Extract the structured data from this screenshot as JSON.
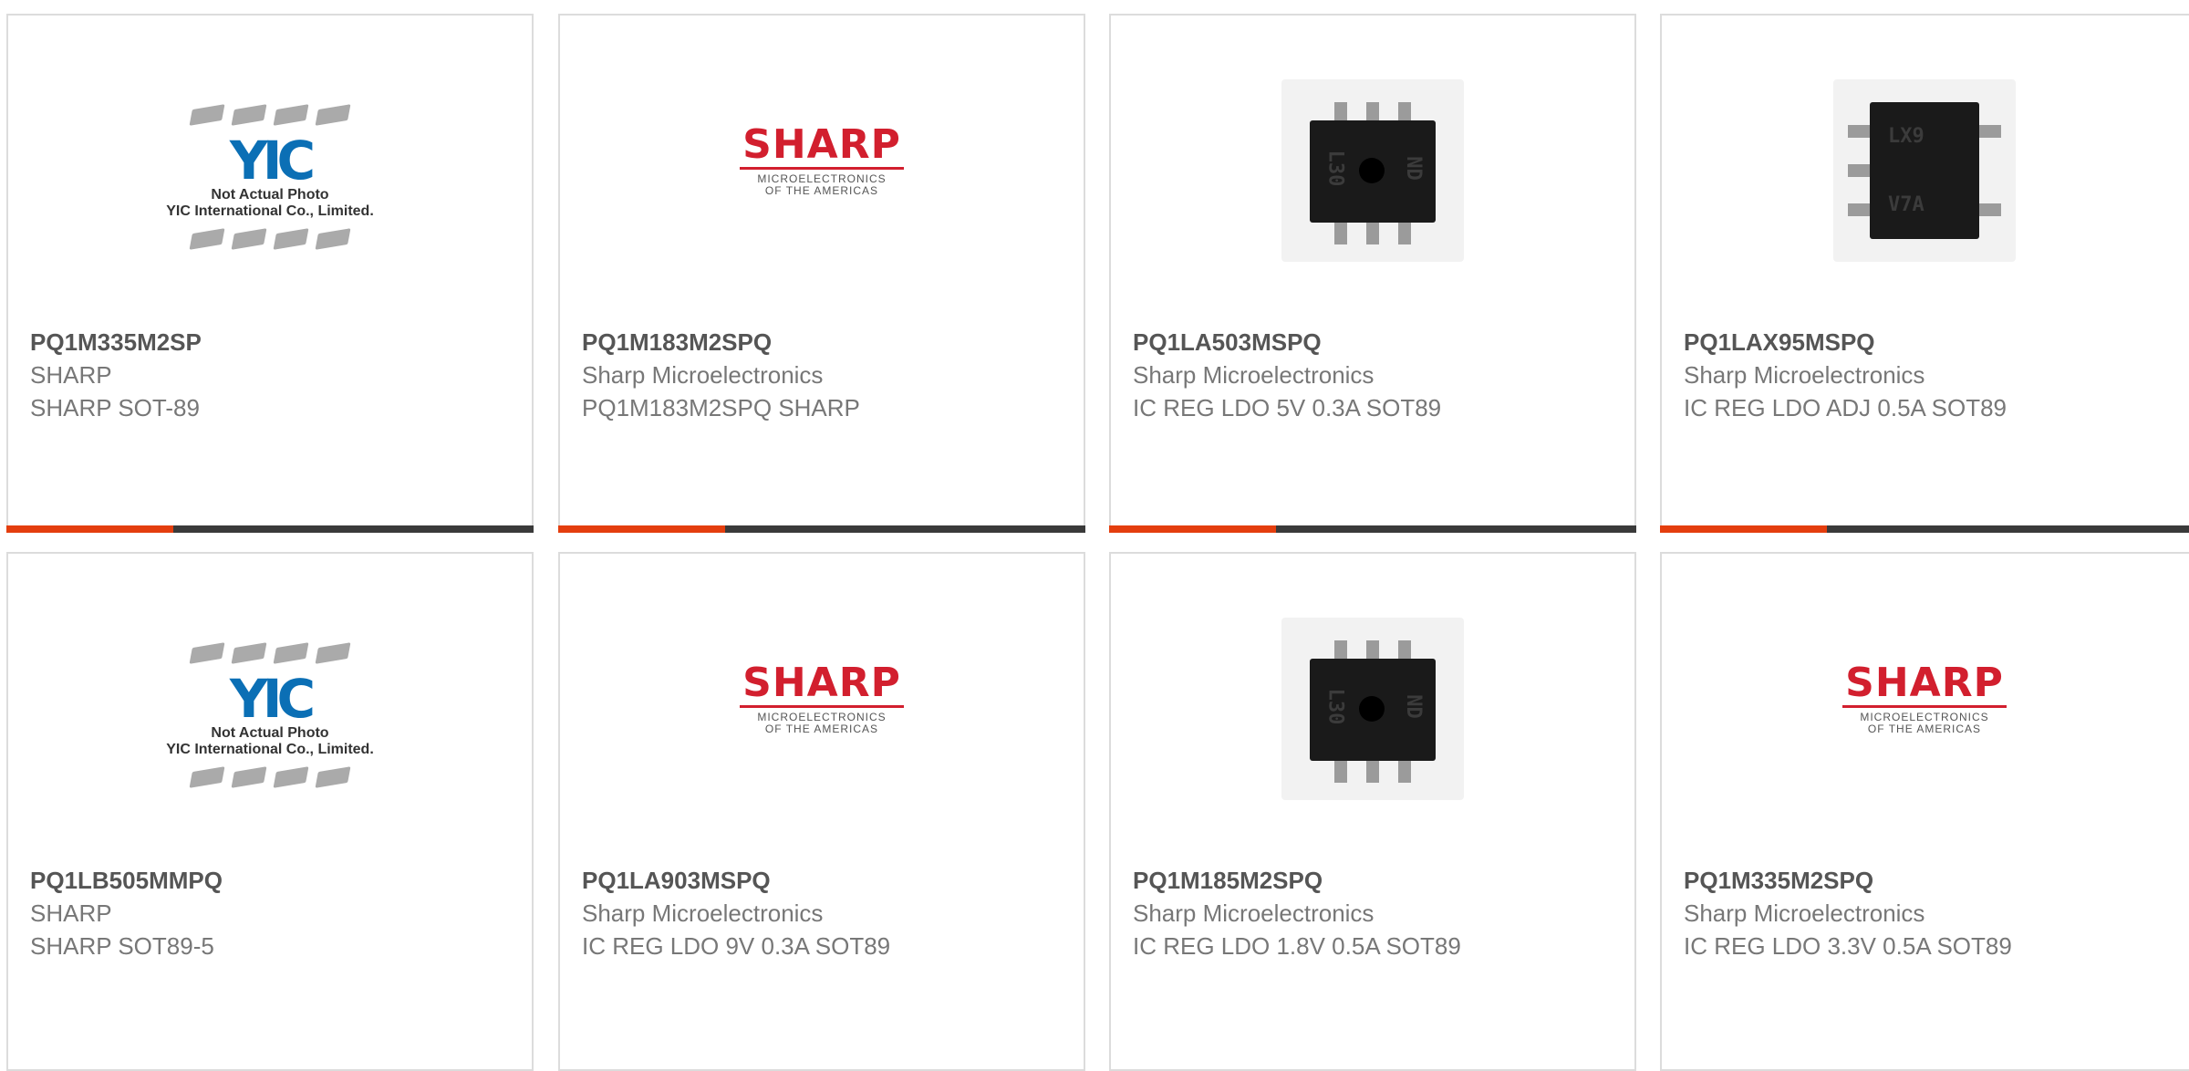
{
  "colors": {
    "accent": "#e43e0e",
    "bar": "#3a3a3a",
    "sharp_red": "#d21f2e",
    "yic_blue": "#0b6fb5"
  },
  "placeholders": {
    "yic_note_line1": "Not Actual Photo",
    "yic_note_line2": "YIC International Co., Limited.",
    "yic_mark": "YIC",
    "sharp_brand": "SHARP",
    "sharp_sub1": "MICROELECTRONICS",
    "sharp_sub2": "OF THE AMERICAS"
  },
  "products": [
    {
      "part_number": "PQ1M335M2SP",
      "manufacturer": "SHARP",
      "description": "SHARP SOT-89",
      "image": "yic-placeholder"
    },
    {
      "part_number": "PQ1M183M2SPQ",
      "manufacturer": "Sharp Microelectronics",
      "description": "PQ1M183M2SPQ SHARP",
      "image": "sharp-logo"
    },
    {
      "part_number": "PQ1LA503MSPQ",
      "manufacturer": "Sharp Microelectronics",
      "description": "IC REG LDO 5V 0.3A SOT89",
      "image": "chip-photo",
      "marking": "L30 ND"
    },
    {
      "part_number": "PQ1LAX95MSPQ",
      "manufacturer": "Sharp Microelectronics",
      "description": "IC REG LDO ADJ 0.5A SOT89",
      "image": "chip-photo",
      "marking": "LX9 V7A"
    },
    {
      "part_number": "PQ1LB505MMPQ",
      "manufacturer": "SHARP",
      "description": "SHARP SOT89-5",
      "image": "yic-placeholder"
    },
    {
      "part_number": "PQ1LA903MSPQ",
      "manufacturer": "Sharp Microelectronics",
      "description": "IC REG LDO 9V 0.3A SOT89",
      "image": "sharp-logo"
    },
    {
      "part_number": "PQ1M185M2SPQ",
      "manufacturer": "Sharp Microelectronics",
      "description": "IC REG LDO 1.8V 0.5A SOT89",
      "image": "chip-photo",
      "marking": "L30 ND"
    },
    {
      "part_number": "PQ1M335M2SPQ",
      "manufacturer": "Sharp Microelectronics",
      "description": "IC REG LDO 3.3V 0.5A SOT89",
      "image": "sharp-logo"
    }
  ]
}
